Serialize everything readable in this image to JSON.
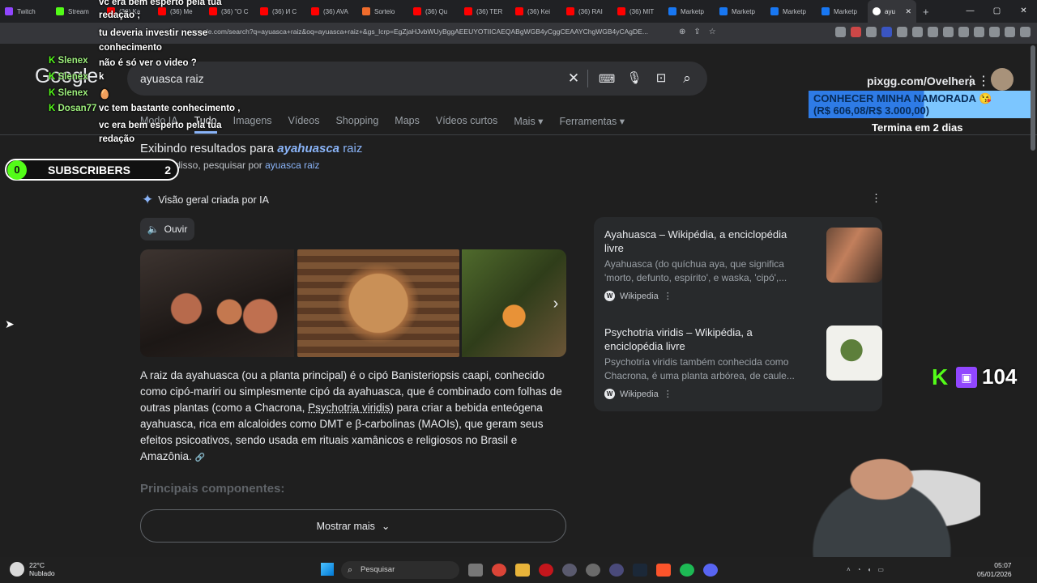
{
  "browser": {
    "tabs": [
      {
        "label": "Twitch",
        "color": "#9146ff"
      },
      {
        "label": "Stream",
        "color": "#53fc18"
      },
      {
        "label": "(36) Ka",
        "color": "#ff0000"
      },
      {
        "label": "(36) Me",
        "color": "#ff0000"
      },
      {
        "label": "(36) \"O C",
        "color": "#ff0000"
      },
      {
        "label": "(36) И С",
        "color": "#ff0000"
      },
      {
        "label": "(36) AVA",
        "color": "#ff0000"
      },
      {
        "label": "Sorteio",
        "color": "#f06c2c"
      },
      {
        "label": "(36) Qu",
        "color": "#ff0000"
      },
      {
        "label": "(36) TER",
        "color": "#ff0000"
      },
      {
        "label": "(36) Kei",
        "color": "#ff0000"
      },
      {
        "label": "(36) RAI",
        "color": "#ff0000"
      },
      {
        "label": "(36) MIT",
        "color": "#ff0000"
      },
      {
        "label": "Marketp",
        "color": "#1877f2"
      },
      {
        "label": "Marketp",
        "color": "#1877f2"
      },
      {
        "label": "Marketp",
        "color": "#1877f2"
      },
      {
        "label": "Marketp",
        "color": "#1877f2"
      }
    ],
    "active_tab": "ayu",
    "url": "google.com/search?q=ayuasca+raiz&oq=ayuasca+raiz+&gs_lcrp=EgZjaHJvbWUyBggAEEUYOTIICAEQABgWGB4yCggCEAAYChgWGB4yCAgDE..."
  },
  "google": {
    "logo": "Google",
    "query": "ayuasca raiz",
    "tabs": [
      "Modo IA",
      "Tudo",
      "Imagens",
      "Vídeos",
      "Shopping",
      "Maps",
      "Vídeos curtos",
      "Mais ▾",
      "Ferramentas ▾"
    ],
    "showing_prefix": "Exibindo resultados para",
    "showing_term": "ayahuasca",
    "showing_suffix": "raiz",
    "instead_prefix": "Em vez disso, pesquisar por",
    "instead_term": "ayuasca raiz",
    "ai_overview_title": "Visão geral criada por IA",
    "listen_label": "Ouvir",
    "ai_text_1": "A raiz da ayahuasca (ou a planta principal) é o cipó Banisteriopsis caapi, conhecido como cipó-mariri ou simplesmente cipó da ayahuasca, que é combinado com folhas de outras plantas (como a Chacrona, ",
    "ai_text_ul": "Psychotria viridis",
    "ai_text_2": ") para criar a bebida enteógena ayahuasca, rica em alcaloides como DMT e β-carbolinas (MAOIs), que geram seus efeitos psicoativos, sendo usada em rituais xamânicos e religiosos no Brasil e Amazônia.",
    "subheading": "Principais componentes:",
    "show_more": "Mostrar mais",
    "sources": [
      {
        "title": "Ayahuasca – Wikipédia, a enciclopédia livre",
        "desc": "Ayahuasca (do quíchua aya, que significa 'morto, defunto, espírito', e waska, 'cipó',...",
        "site": "Wikipedia"
      },
      {
        "title": "Psychotria viridis – Wikipédia, a enciclopédia livre",
        "desc": "Psychotria viridis também conhecida como Chacrona, é uma planta arbórea, de caule...",
        "site": "Wikipedia"
      }
    ]
  },
  "overlay": {
    "chat": [
      {
        "user": "",
        "msg": "vc era bem esperto pela tua"
      },
      {
        "user": "",
        "msg": "redação ;"
      },
      {
        "user": "",
        "msg": "tu deveria investir nesse"
      },
      {
        "user": "",
        "msg": "conhecimento"
      },
      {
        "user": "",
        "msg": "não é só ver o video ?"
      },
      {
        "user": "Slenex",
        "msg": ""
      },
      {
        "user": "Slenex",
        "msg": "k"
      },
      {
        "user": "Slenex",
        "msg": "🥚"
      },
      {
        "user": "Dosan77",
        "msg": "vc tem bastante conhecimento ,"
      },
      {
        "user": "",
        "msg": "vc era bem esperto pela tua"
      },
      {
        "user": "",
        "msg": "redação"
      }
    ],
    "sub_count": "0",
    "sub_label": "SUBSCRIBERS",
    "sub_goal": "2",
    "pix": "pixgg.com/Ovelhera",
    "goal_title": "CONHECER MINHA NAMORADA 😘",
    "goal_amount": "(R$ 606,08/R$ 3.000,00)",
    "goal_progress": 0.2,
    "goal_sub": "Termina em 2 dias",
    "viewers": "104"
  },
  "taskbar": {
    "temp": "22°C",
    "weather": "Nublado",
    "search": "Pesquisar",
    "time": "05:07",
    "date": "05/01/2026"
  }
}
